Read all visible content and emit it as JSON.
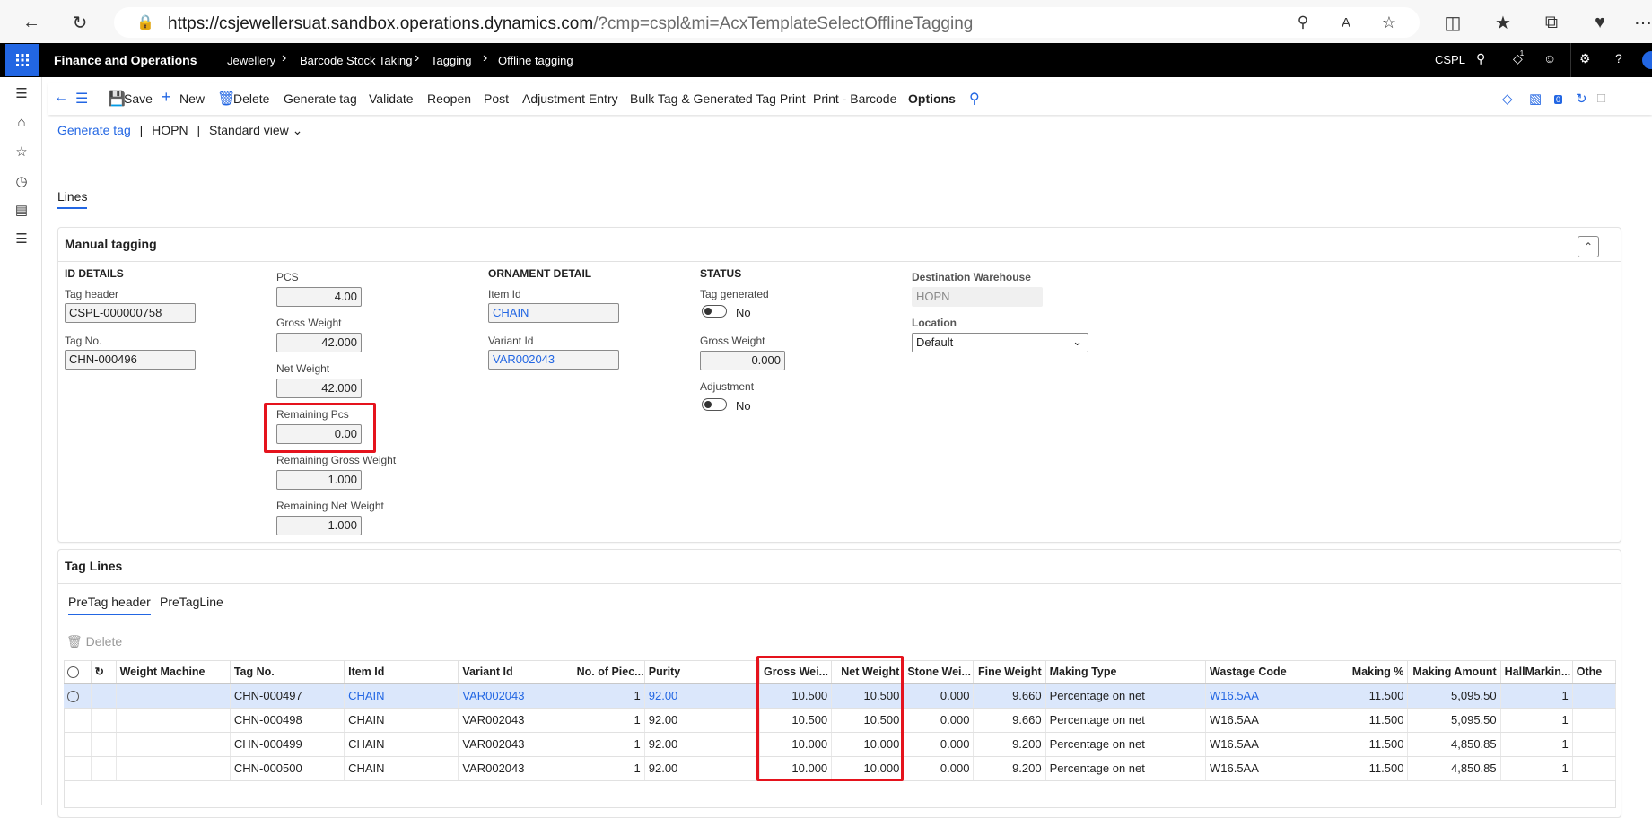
{
  "browser": {
    "url_host": "https://csjewellersuat.sandbox.operations.dynamics.com",
    "url_rest": "/?cmp=cspl&mi=AcxTemplateSelectOfflineTagging"
  },
  "header": {
    "app_title": "Finance and Operations",
    "breadcrumbs": [
      "Jewellery",
      "Barcode Stock Taking",
      "Tagging",
      "Offline tagging"
    ],
    "company": "CSPL",
    "notification_count": "1"
  },
  "toolbar": {
    "save": "Save",
    "new": "New",
    "delete": "Delete",
    "generate_tag": "Generate tag",
    "validate": "Validate",
    "reopen": "Reopen",
    "post": "Post",
    "adjustment_entry": "Adjustment Entry",
    "bulk_print": "Bulk Tag & Generated Tag Print",
    "print_barcode": "Print - Barcode",
    "options": "Options",
    "attach_count": "0"
  },
  "page": {
    "link": "Generate tag",
    "record": "HOPN",
    "view": "Standard view",
    "lines_tab": "Lines"
  },
  "manual_tagging": {
    "title": "Manual tagging",
    "id_details": {
      "heading": "ID DETAILS",
      "tag_header_label": "Tag header",
      "tag_header_value": "CSPL-000000758",
      "tag_no_label": "Tag No.",
      "tag_no_value": "CHN-000496"
    },
    "quantities": {
      "pcs_label": "PCS",
      "pcs_value": "4.00",
      "gross_label": "Gross Weight",
      "gross_value": "42.000",
      "net_label": "Net Weight",
      "net_value": "42.000",
      "rem_pcs_label": "Remaining Pcs",
      "rem_pcs_value": "0.00",
      "rem_gross_label": "Remaining Gross Weight",
      "rem_gross_value": "1.000",
      "rem_net_label": "Remaining Net Weight",
      "rem_net_value": "1.000"
    },
    "ornament": {
      "heading": "ORNAMENT DETAIL",
      "item_label": "Item Id",
      "item_value": "CHAIN",
      "variant_label": "Variant Id",
      "variant_value": "VAR002043"
    },
    "status": {
      "heading": "STATUS",
      "tag_generated_label": "Tag generated",
      "tag_generated_value": "No",
      "gross_label": "Gross Weight",
      "gross_value": "0.000",
      "adjustment_label": "Adjustment",
      "adjustment_value": "No"
    },
    "destination": {
      "warehouse_label": "Destination Warehouse",
      "warehouse_value": "HOPN",
      "location_label": "Location",
      "location_value": "Default"
    }
  },
  "tag_lines": {
    "title": "Tag Lines",
    "tabs": [
      "PreTag header",
      "PreTagLine"
    ],
    "delete": "Delete",
    "columns": [
      "Weight Machine",
      "Tag No.",
      "Item Id",
      "Variant Id",
      "No. of Piec...",
      "Purity",
      "Gross Wei...",
      "Net Weight",
      "Stone Wei...",
      "Fine Weight",
      "Making Type",
      "Wastage Code",
      "Making %",
      "Making Amount",
      "HallMarkin...",
      "Othe"
    ],
    "rows": [
      {
        "machine": "",
        "tag": "CHN-000497",
        "item": "CHAIN",
        "variant": "VAR002043",
        "pcs": "1",
        "purity": "92.00",
        "gross": "10.500",
        "net": "10.500",
        "stone": "0.000",
        "fine": "9.660",
        "making_type": "Percentage on net",
        "wastage": "W16.5AA",
        "making_pct": "11.500",
        "making_amt": "5,095.50",
        "hallmark": "1"
      },
      {
        "machine": "",
        "tag": "CHN-000498",
        "item": "CHAIN",
        "variant": "VAR002043",
        "pcs": "1",
        "purity": "92.00",
        "gross": "10.500",
        "net": "10.500",
        "stone": "0.000",
        "fine": "9.660",
        "making_type": "Percentage on net",
        "wastage": "W16.5AA",
        "making_pct": "11.500",
        "making_amt": "5,095.50",
        "hallmark": "1"
      },
      {
        "machine": "",
        "tag": "CHN-000499",
        "item": "CHAIN",
        "variant": "VAR002043",
        "pcs": "1",
        "purity": "92.00",
        "gross": "10.000",
        "net": "10.000",
        "stone": "0.000",
        "fine": "9.200",
        "making_type": "Percentage on net",
        "wastage": "W16.5AA",
        "making_pct": "11.500",
        "making_amt": "4,850.85",
        "hallmark": "1"
      },
      {
        "machine": "",
        "tag": "CHN-000500",
        "item": "CHAIN",
        "variant": "VAR002043",
        "pcs": "1",
        "purity": "92.00",
        "gross": "10.000",
        "net": "10.000",
        "stone": "0.000",
        "fine": "9.200",
        "making_type": "Percentage on net",
        "wastage": "W16.5AA",
        "making_pct": "11.500",
        "making_amt": "4,850.85",
        "hallmark": "1"
      }
    ]
  },
  "colors": {
    "accent": "#2266e3",
    "highlight": "#e5131d",
    "selected_row": "#dbe7fb"
  }
}
